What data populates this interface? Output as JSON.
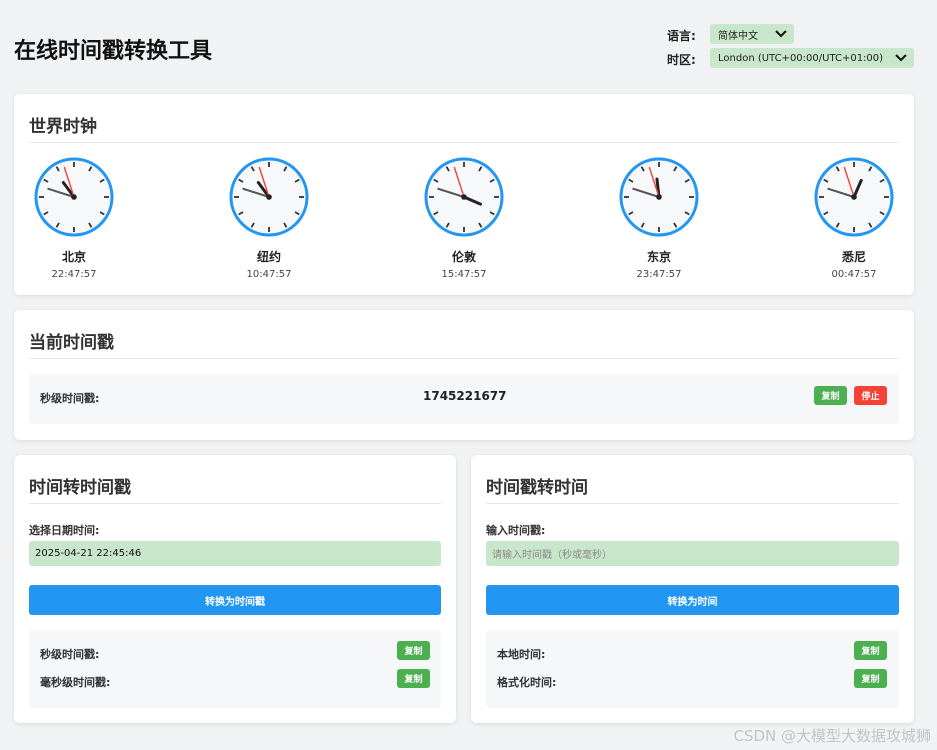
{
  "header": {
    "title": "在线时间戳转换工具",
    "language_label": "语言:",
    "language_value": "简体中文",
    "timezone_label": "时区:",
    "timezone_value": "London (UTC+00:00/UTC+01:00)"
  },
  "world_clock": {
    "title": "世界时钟",
    "clocks": [
      {
        "city": "北京",
        "time": "22:47:57",
        "hour": 22,
        "minute": 47,
        "second": 57
      },
      {
        "city": "纽约",
        "time": "10:47:57",
        "hour": 10,
        "minute": 47,
        "second": 57
      },
      {
        "city": "伦敦",
        "time": "15:47:57",
        "hour": 15,
        "minute": 47,
        "second": 57
      },
      {
        "city": "东京",
        "time": "23:47:57",
        "hour": 23,
        "minute": 47,
        "second": 57
      },
      {
        "city": "悉尼",
        "time": "00:47:57",
        "hour": 0,
        "minute": 47,
        "second": 57
      }
    ]
  },
  "current": {
    "title": "当前时间戳",
    "label": "秒级时间戳:",
    "value": "1745221677",
    "copy_label": "复制",
    "stop_label": "停止"
  },
  "to_timestamp": {
    "title": "时间转时间戳",
    "input_label": "选择日期时间:",
    "input_value": "2025-04-21 22:45:46",
    "button_label": "转换为时间戳",
    "result_seconds_label": "秒级时间戳:",
    "result_ms_label": "毫秒级时间戳:",
    "copy_label": "复制"
  },
  "to_time": {
    "title": "时间戳转时间",
    "input_label": "输入时间戳:",
    "input_placeholder": "请输入时间戳（秒或毫秒）",
    "button_label": "转换为时间",
    "result_local_label": "本地时间:",
    "result_formatted_label": "格式化时间:",
    "copy_label": "复制"
  },
  "watermark": "CSDN @大模型大数据攻城狮",
  "colors": {
    "accent_blue": "#2196f3",
    "copy_green": "#4caf50",
    "stop_red": "#f44336",
    "input_green": "#c8e6c9",
    "clock_rim": "#2196f3",
    "second_hand": "#f44336"
  },
  "icons": {
    "dropdown": "chevron-down-icon"
  }
}
